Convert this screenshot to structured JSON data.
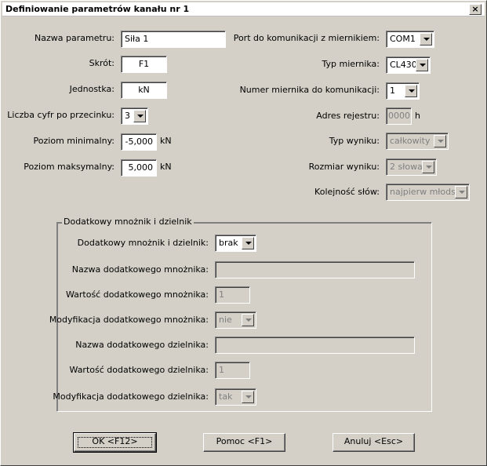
{
  "window": {
    "title": "Definiowanie parametrów kanału nr 1",
    "close_glyph": "×"
  },
  "left": {
    "param_name_label": "Nazwa parametru:",
    "param_name_value": "Siła 1",
    "short_label": "Skrót:",
    "short_value": "F1",
    "unit_label": "Jednostka:",
    "unit_value": "kN",
    "digits_label": "Liczba cyfr po przecinku:",
    "digits_value": "3",
    "min_label": "Poziom minimalny:",
    "min_value": "-5,000",
    "min_unit": "kN",
    "max_label": "Poziom maksymalny:",
    "max_value": "5,000",
    "max_unit": "kN"
  },
  "right": {
    "port_label": "Port do komunikacji z miernikiem:",
    "port_value": "COM1",
    "meter_type_label": "Typ miernika:",
    "meter_type_value": "CL430",
    "meter_num_label": "Numer miernika do komunikacji:",
    "meter_num_value": "1",
    "register_label": "Adres rejestru:",
    "register_value": "0000",
    "register_suffix": "h",
    "result_type_label": "Typ wyniku:",
    "result_type_value": "całkowity",
    "result_size_label": "Rozmiar wyniku:",
    "result_size_value": "2 słowa",
    "word_order_label": "Kolejność słów:",
    "word_order_value": "najpierw młodsze"
  },
  "group": {
    "legend": "Dodatkowy mnożnik i dzielnik",
    "md_label": "Dodatkowy mnożnik i dzielnik:",
    "md_value": "brak",
    "mult_name_label": "Nazwa dodatkowego mnożnika:",
    "mult_name_value": "",
    "mult_value_label": "Wartość dodatkowego mnożnika:",
    "mult_value_value": "1",
    "mult_mod_label": "Modyfikacja dodatkowego mnożnika:",
    "mult_mod_value": "nie",
    "div_name_label": "Nazwa dodatkowego dzielnika:",
    "div_name_value": "",
    "div_value_label": "Wartość dodatkowego dzielnika:",
    "div_value_value": "1",
    "div_mod_label": "Modyfikacja dodatkowego dzielnika:",
    "div_mod_value": "tak"
  },
  "buttons": {
    "ok": "OK  <F12>",
    "help": "Pomoc  <F1>",
    "cancel": "Anuluj  <Esc>"
  }
}
